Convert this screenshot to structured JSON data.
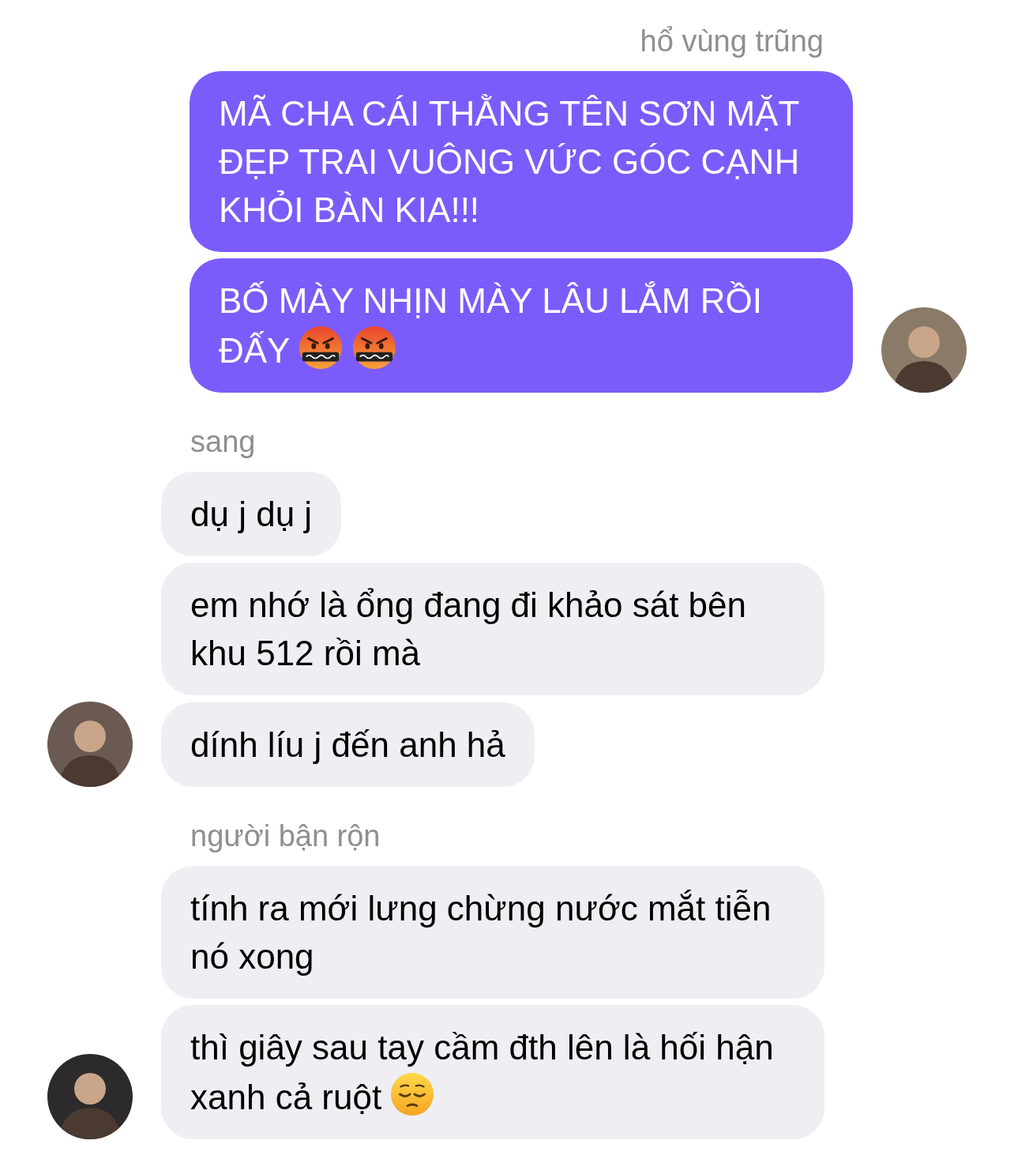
{
  "groups": [
    {
      "kind": "outgoing",
      "sender": "hổ vùng trũng",
      "bubbles": [
        {
          "text": "MÃ CHA CÁI THẰNG TÊN SƠN MẶT ĐẸP TRAI VUÔNG VỨC GÓC CẠNH KHỎI BÀN KIA!!!"
        },
        {
          "text": "BỐ MÀY NHỊN MÀY LÂU LẮM RỒI ĐẤY",
          "emojis": [
            {
              "kind": "cursing"
            },
            {
              "kind": "cursing"
            }
          ]
        }
      ]
    },
    {
      "kind": "incoming",
      "sender": "sang",
      "bubbles": [
        {
          "text": "dụ j dụ j"
        },
        {
          "text": "em nhớ là ổng đang đi khảo sát bên khu 512 rồi mà"
        },
        {
          "text": "dính líu j đến anh hả"
        }
      ]
    },
    {
      "kind": "incoming",
      "sender": "người bận rộn",
      "bubbles": [
        {
          "text": "tính ra mới lưng chừng nước mắt tiễn nó xong"
        },
        {
          "text": "thì giây sau tay cầm đth lên là hối hận xanh cả ruột",
          "emojis": [
            {
              "kind": "pensive"
            }
          ]
        }
      ]
    }
  ]
}
